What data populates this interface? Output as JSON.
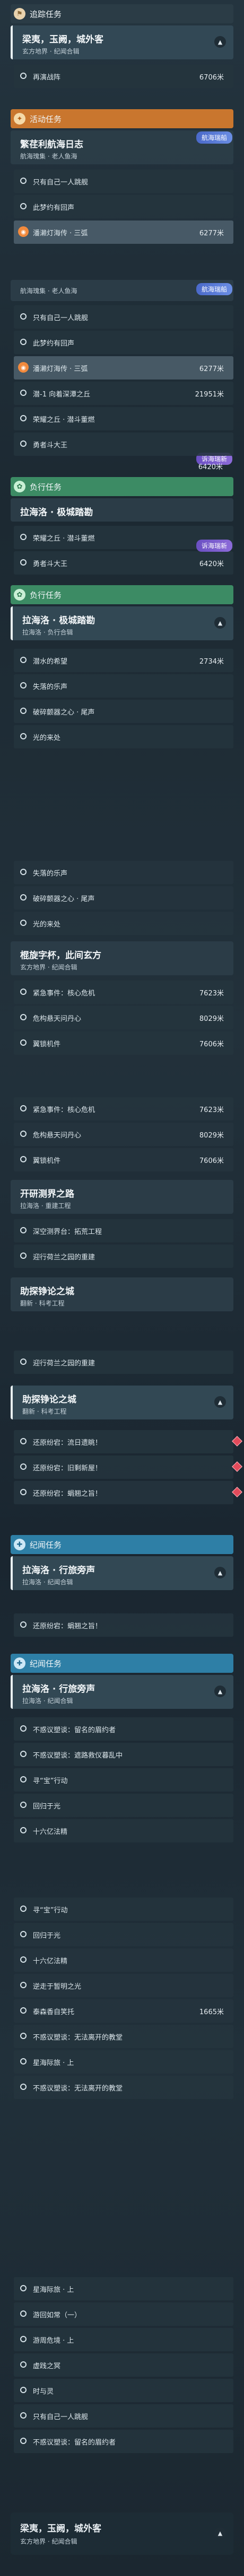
{
  "colors": {
    "orange": "#c9762e",
    "green": "#3c8b64",
    "blue": "#2e7fa6",
    "distance_text": "#e8eef2",
    "pin": "#f28a3d"
  },
  "tracked": {
    "label": "追踪任务",
    "title": "梁夷，玉阙，城外客",
    "subtitle": "玄方地界 · 纪闻合辑",
    "step": "再演战阵",
    "distance": "6706米"
  },
  "event": {
    "label": "活动任务",
    "title": "繁荏利航海日志",
    "subtitle": "航海瑰集 · 老人鱼海",
    "steps": [
      "只有自己一人跳舰",
      "此梦约有回声",
      "潘濑灯海传 · 三弧",
      "潜-1 向着深潭之丘",
      "荣耀之丘 · 潜斗董燃",
      "勇者斗大王"
    ],
    "dist_sel": "6277米",
    "dist_dive": "21951米",
    "dist_glory": "6420米",
    "tag": "航海瑞船",
    "tag2": "诉海瑞新"
  },
  "heart": {
    "label": "负行任务",
    "title": "拉海洛 · 极城踏勘",
    "subtitle": "拉海洛 · 负行合辑",
    "steps": [
      "荣耀之丘 · 潜斗董燃",
      "勇者斗大王"
    ],
    "dist": "6420米",
    "badge": "诉海瑞新"
  },
  "side": {
    "label": "负行任务",
    "title": "拉海洛 · 极城踏勘",
    "subtitle": "拉海洛 · 负行合辑",
    "steps": [
      "潜水的希望",
      "失落的乐声",
      "破碎颤器之心 · 尾声",
      "光的来处"
    ],
    "dist": "2734米"
  },
  "xuanfang": {
    "title": "棍旋字杯，此间玄方",
    "subtitle": "玄方地界 · 纪闻合辑",
    "steps": [
      "紧急事件：核心危机",
      "危构悬天问丹心",
      "翼锁机件"
    ],
    "dists": [
      "7623米",
      "8029米",
      "7606米"
    ]
  },
  "kaiyan": {
    "title": "开研测界之路",
    "subtitle": "拉海洛 · 重建工程",
    "steps": [
      "深空测界台：拓荒工程",
      "迎行荷兰之园的重建"
    ]
  },
  "zhuyu": {
    "title": "助探铮论之城",
    "subtitle": "翻新 · 科考工程",
    "steps": [
      "迎行荷兰之园的重建",
      "还原纷宕：流日遗眺！",
      "还原纷宕：旧剩新屋！",
      "还原纷宕：蜎翘之旨！"
    ]
  },
  "story": {
    "label": "纪闻任务",
    "title": "拉海洛 · 行旅旁声",
    "subtitle": "拉海洛 · 纪闻合辑",
    "steps": [
      "还原纷宕：蜎翘之旨！"
    ]
  },
  "story2": {
    "label": "纪闻任务",
    "title": "拉海洛 · 行旅旁声",
    "subtitle": "拉海洛 · 纪闻合辑",
    "steps": [
      "不惑议塑谈：留名的眉约者",
      "不惑议塑谈：遮路救仪暮乱中",
      "寻“宝”行动",
      "回归于光",
      "十六亿法精",
      "寻“宝”行动",
      "回归于光",
      "十六亿法精",
      "逆走于暂明之光",
      "泰森香自笑托",
      "不惑议塑谈：无法离开的教堂",
      "星海际旅 · 上",
      "不惑议塑谈：无法离开的教堂",
      "星海际旅 · 上",
      "游回如常（一）",
      "游周危境 · 上",
      "虚践之冥",
      "时与灵",
      "只有自己一人跳舰"
    ],
    "dist_home": "1665米"
  },
  "bottom": {
    "title": "梁夷，玉阙，城外客",
    "subtitle": "玄方地界 · 纪闻合辑"
  }
}
